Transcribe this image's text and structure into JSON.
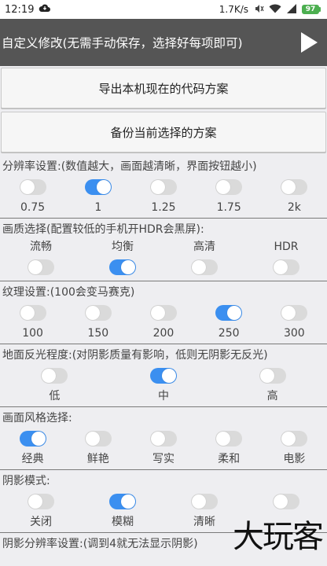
{
  "status": {
    "time": "12:19",
    "net_speed": "1.7K/s",
    "battery": "97"
  },
  "toolbar": {
    "title": "自定义修改(无需手动保存，选择好每项即可)"
  },
  "buttons": {
    "export": "导出本机现在的代码方案",
    "backup": "备份当前选择的方案"
  },
  "resolution": {
    "title": "分辨率设置:(数值越大，画面越清晰，界面按钮越小)",
    "options": [
      {
        "label": "0.75",
        "on": false
      },
      {
        "label": "1",
        "on": true
      },
      {
        "label": "1.25",
        "on": false
      },
      {
        "label": "1.75",
        "on": false
      },
      {
        "label": "2k",
        "on": false
      }
    ]
  },
  "quality": {
    "title": "画质选择(配置较低的手机开HDR会黑屏):",
    "options": [
      {
        "label": "流畅",
        "on": false
      },
      {
        "label": "均衡",
        "on": true
      },
      {
        "label": "高清",
        "on": false
      },
      {
        "label": "HDR",
        "on": false
      }
    ]
  },
  "texture": {
    "title": "纹理设置:(100会变马赛克)",
    "options": [
      {
        "label": "100",
        "on": false
      },
      {
        "label": "150",
        "on": false
      },
      {
        "label": "200",
        "on": false
      },
      {
        "label": "250",
        "on": true
      },
      {
        "label": "300",
        "on": false
      }
    ]
  },
  "reflection": {
    "title": "地面反光程度:(对阴影质量有影响，低则无阴影无反光)",
    "options": [
      {
        "label": "低",
        "on": false
      },
      {
        "label": "中",
        "on": true
      },
      {
        "label": "高",
        "on": false
      }
    ]
  },
  "style": {
    "title": "画面风格选择:",
    "options": [
      {
        "label": "经典",
        "on": true
      },
      {
        "label": "鲜艳",
        "on": false
      },
      {
        "label": "写实",
        "on": false
      },
      {
        "label": "柔和",
        "on": false
      },
      {
        "label": "电影",
        "on": false
      }
    ]
  },
  "shadow": {
    "title": "阴影模式:",
    "options": [
      {
        "label": "关闭",
        "on": false
      },
      {
        "label": "模糊",
        "on": true
      },
      {
        "label": "清晰",
        "on": false
      },
      {
        "label": "",
        "on": false
      }
    ]
  },
  "shadow_res": {
    "title": "阴影分辨率设置:(调到4就无法显示阴影)"
  },
  "watermark": "大玩客",
  "colors": {
    "toolbar": "#555555",
    "switch_on": "#3b8ff0",
    "switch_off": "#dadada",
    "battery": "#4caf50"
  }
}
